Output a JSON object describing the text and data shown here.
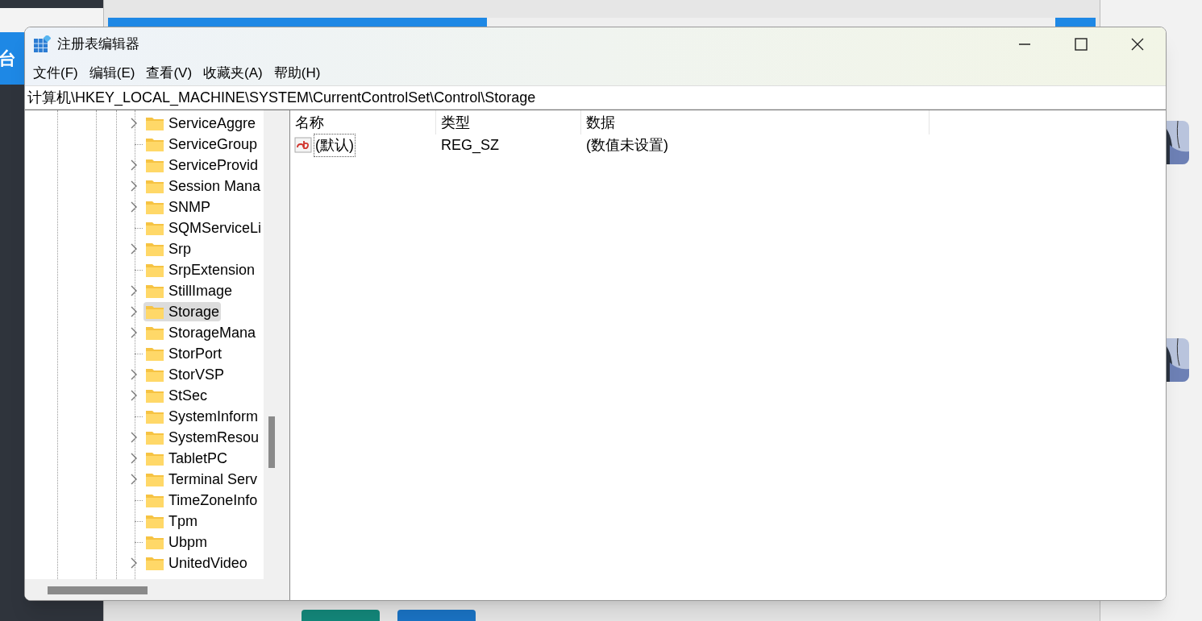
{
  "background": {
    "side_label": "台"
  },
  "window": {
    "title": "注册表编辑器",
    "controls": [
      {
        "kind": "minimize"
      },
      {
        "kind": "maximize"
      },
      {
        "kind": "close"
      }
    ]
  },
  "menu": [
    "文件(F)",
    "编辑(E)",
    "查看(V)",
    "收藏夹(A)",
    "帮助(H)"
  ],
  "address": "计算机\\HKEY_LOCAL_MACHINE\\SYSTEM\\CurrentControlSet\\Control\\Storage",
  "tree": [
    {
      "label": "ServiceAggre",
      "expandable": true,
      "selected": false
    },
    {
      "label": "ServiceGroup",
      "expandable": false,
      "selected": false
    },
    {
      "label": "ServiceProvid",
      "expandable": true,
      "selected": false
    },
    {
      "label": "Session Mana",
      "expandable": true,
      "selected": false
    },
    {
      "label": "SNMP",
      "expandable": true,
      "selected": false
    },
    {
      "label": "SQMServiceLi",
      "expandable": false,
      "selected": false
    },
    {
      "label": "Srp",
      "expandable": true,
      "selected": false
    },
    {
      "label": "SrpExtension",
      "expandable": false,
      "selected": false
    },
    {
      "label": "StillImage",
      "expandable": true,
      "selected": false
    },
    {
      "label": "Storage",
      "expandable": true,
      "selected": true
    },
    {
      "label": "StorageMana",
      "expandable": true,
      "selected": false
    },
    {
      "label": "StorPort",
      "expandable": false,
      "selected": false
    },
    {
      "label": "StorVSP",
      "expandable": true,
      "selected": false
    },
    {
      "label": "StSec",
      "expandable": true,
      "selected": false
    },
    {
      "label": "SystemInform",
      "expandable": false,
      "selected": false
    },
    {
      "label": "SystemResou",
      "expandable": true,
      "selected": false
    },
    {
      "label": "TabletPC",
      "expandable": true,
      "selected": false
    },
    {
      "label": "Terminal Serv",
      "expandable": true,
      "selected": false
    },
    {
      "label": "TimeZoneInfo",
      "expandable": false,
      "selected": false
    },
    {
      "label": "Tpm",
      "expandable": false,
      "selected": false
    },
    {
      "label": "Ubpm",
      "expandable": false,
      "selected": false
    },
    {
      "label": "UnitedVideo",
      "expandable": true,
      "selected": false
    }
  ],
  "table": {
    "columns": [
      "名称",
      "类型",
      "数据"
    ],
    "rows": [
      {
        "kind": "string",
        "name": "(默认)",
        "type": "REG_SZ",
        "data": "(数值未设置)"
      }
    ]
  }
}
